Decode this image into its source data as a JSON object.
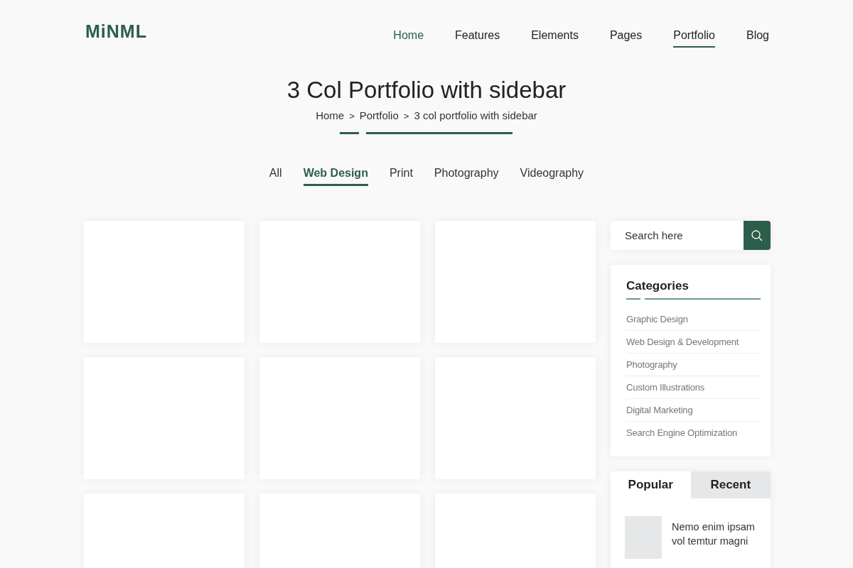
{
  "logo": "MiNML",
  "nav": [
    {
      "label": "Home",
      "current": true,
      "selected": false
    },
    {
      "label": "Features",
      "current": false,
      "selected": false
    },
    {
      "label": "Elements",
      "current": false,
      "selected": false
    },
    {
      "label": "Pages",
      "current": false,
      "selected": false
    },
    {
      "label": "Portfolio",
      "current": false,
      "selected": true
    },
    {
      "label": "Blog",
      "current": false,
      "selected": false
    }
  ],
  "page_title": "3 Col Portfolio with sidebar",
  "breadcrumb": [
    {
      "label": "Home"
    },
    {
      "label": "Portfolio"
    },
    {
      "label": "3 col portfolio with sidebar"
    }
  ],
  "breadcrumb_separator": ">",
  "filters": [
    {
      "label": "All",
      "selected": false
    },
    {
      "label": "Web Design",
      "selected": true
    },
    {
      "label": "Print",
      "selected": false
    },
    {
      "label": "Photography",
      "selected": false
    },
    {
      "label": "Videography",
      "selected": false
    }
  ],
  "portfolio_items": [
    {
      "kind": "card"
    },
    {
      "kind": "card"
    },
    {
      "kind": "card"
    },
    {
      "kind": "card"
    },
    {
      "kind": "card"
    },
    {
      "kind": "card"
    },
    {
      "kind": "card"
    },
    {
      "kind": "card"
    },
    {
      "kind": "card"
    }
  ],
  "sidebar": {
    "search": {
      "placeholder": "Search here"
    },
    "categories": {
      "title": "Categories",
      "items": [
        "Graphic Design",
        "Web Design & Development",
        "Photography",
        "Custom Illustrations",
        "Digital Marketing",
        "Search Engine Optimization"
      ]
    },
    "post_tabs": [
      {
        "label": "Popular",
        "selected": true
      },
      {
        "label": "Recent",
        "selected": false
      }
    ],
    "posts": [
      {
        "title": "Nemo enim ipsam vol temtur magni"
      }
    ]
  }
}
